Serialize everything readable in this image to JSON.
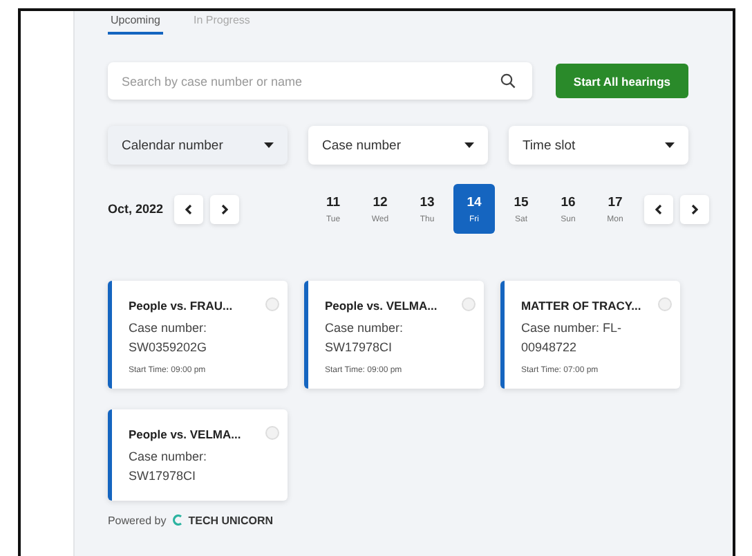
{
  "tabs": [
    {
      "label": "Upcoming",
      "selected": true
    },
    {
      "label": "In Progress",
      "selected": false
    }
  ],
  "search": {
    "placeholder": "Search by case number or name"
  },
  "start_button": "Start All hearings",
  "filters": [
    {
      "label": "Calendar number"
    },
    {
      "label": "Case number"
    },
    {
      "label": "Time slot"
    }
  ],
  "month": "Oct, 2022",
  "days": [
    {
      "date": "11",
      "weekday": "Tue",
      "selected": false
    },
    {
      "date": "12",
      "weekday": "Wed",
      "selected": false
    },
    {
      "date": "13",
      "weekday": "Thu",
      "selected": false
    },
    {
      "date": "14",
      "weekday": "Fri",
      "selected": true
    },
    {
      "date": "15",
      "weekday": "Sat",
      "selected": false
    },
    {
      "date": "16",
      "weekday": "Sun",
      "selected": false
    },
    {
      "date": "17",
      "weekday": "Mon",
      "selected": false
    }
  ],
  "cases": [
    {
      "title": "People vs. FRAU...",
      "case_number": "Case number: SW0359202G",
      "start_time": "Start Time: 09:00 pm",
      "selected": false
    },
    {
      "title": "People vs. VELMA...",
      "case_number": "Case number: SW17978CI",
      "start_time": "Start Time: 09:00 pm",
      "selected": false
    },
    {
      "title": "MATTER OF TRACY...",
      "case_number": "Case number: FL-00948722",
      "start_time": "Start Time: 07:00 pm",
      "selected": false
    },
    {
      "title": "People vs. VELMA...",
      "case_number": "Case number: SW17978CI",
      "selected": false
    }
  ],
  "footer": {
    "prefix": "Powered by",
    "brand": "TECH UNICORN"
  }
}
